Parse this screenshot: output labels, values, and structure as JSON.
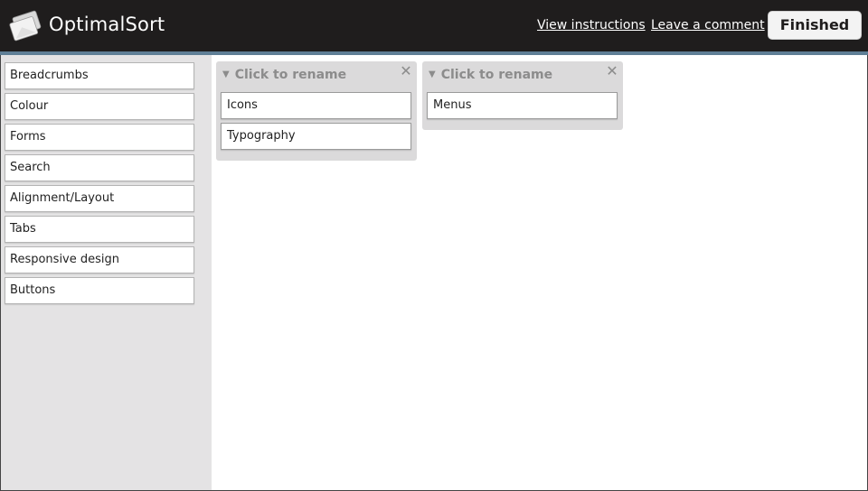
{
  "header": {
    "brand": "OptimalSort",
    "view_instructions": "View instructions",
    "leave_comment": "Leave a comment",
    "finished": "Finished"
  },
  "sidebar": {
    "cards": [
      "Breadcrumbs",
      "Colour",
      "Forms",
      "Search",
      "Alignment/Layout",
      "Tabs",
      "Responsive design",
      "Buttons"
    ]
  },
  "groups": [
    {
      "title": "Click to rename",
      "cards": [
        "Icons",
        "Typography"
      ]
    },
    {
      "title": "Click to rename",
      "cards": [
        "Menus"
      ]
    }
  ],
  "colors": {
    "header_bg": "#1f1d1d",
    "accent_rule": "#5f7f96",
    "sidebar_bg": "#e4e3e4",
    "group_bg": "#dbdadb"
  }
}
